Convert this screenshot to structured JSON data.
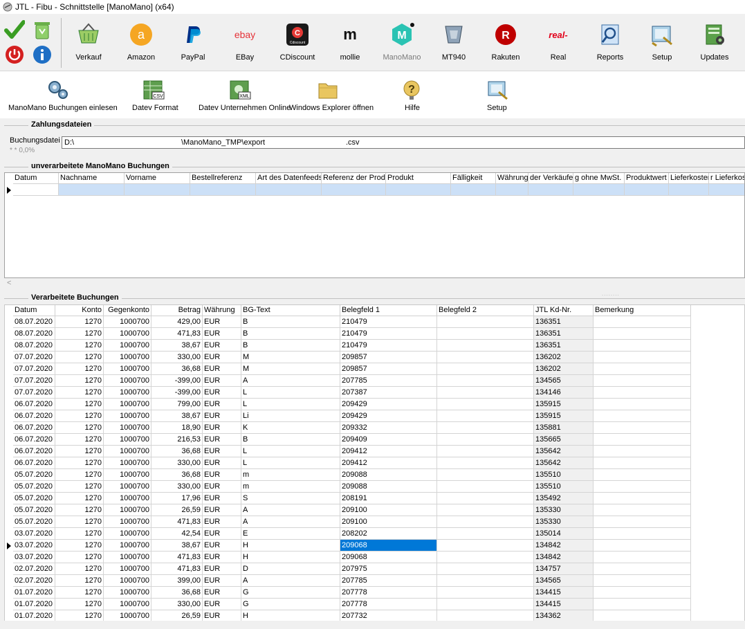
{
  "window": {
    "title": "JTL - Fibu - Schnittstelle [ManoMano] (x64)"
  },
  "toolbar": {
    "items": [
      {
        "label": "Verkauf",
        "icon": "shopping-basket-icon"
      },
      {
        "label": "Amazon",
        "icon": "amazon-icon"
      },
      {
        "label": "PayPal",
        "icon": "paypal-icon"
      },
      {
        "label": "EBay",
        "icon": "ebay-icon"
      },
      {
        "label": "CDiscount",
        "icon": "cdiscount-icon"
      },
      {
        "label": "mollie",
        "icon": "mollie-icon"
      },
      {
        "label": "ManoMano",
        "icon": "manomano-icon"
      },
      {
        "label": "MT940",
        "icon": "mt940-icon"
      },
      {
        "label": "Rakuten",
        "icon": "rakuten-icon"
      },
      {
        "label": "Real",
        "icon": "real-icon"
      },
      {
        "label": "Reports",
        "icon": "reports-icon"
      },
      {
        "label": "Setup",
        "icon": "setup-icon"
      },
      {
        "label": "Updates",
        "icon": "updates-icon"
      }
    ],
    "ebay_text": "ebay",
    "cdiscount_text": "Cdiscount",
    "mollie_text": "m",
    "rakuten_text": "R",
    "real_text": "real-",
    "manomano_text": "M"
  },
  "subtoolbar": {
    "items": [
      {
        "label": "ManoMano Buchungen einlesen",
        "icon": "gears-icon"
      },
      {
        "label": "Datev Format",
        "icon": "csv-file-icon"
      },
      {
        "label": "Datev Unternehmen Online",
        "icon": "xml-file-icon"
      },
      {
        "label": "Windows Explorer öffnen",
        "icon": "folder-icon"
      },
      {
        "label": "Hilfe",
        "icon": "help-icon"
      },
      {
        "label": "Setup",
        "icon": "setup-icon"
      }
    ],
    "csv_text": "CSV",
    "xml_text": "XML",
    "help_glyph": "?"
  },
  "payment_files": {
    "title": "Zahlungsdateien",
    "label": "Buchungsdatei",
    "progress": "* * 0,0%",
    "path_parts": [
      "D:\\",
      "\\ManoMano_TMP\\export",
      ".csv"
    ]
  },
  "unprocessed": {
    "title": "unverarbeitete ManoMano Buchungen",
    "columns": [
      "Datum",
      "Nachname",
      "Vorname",
      "Bestellreferenz",
      "Art des Datenfeeds",
      "Referenz der Produl",
      "Produkt",
      "Fälligkeit",
      "Währung",
      "der Verkäufe",
      "g ohne MwSt.",
      "Produktwert",
      "Lieferkosten",
      "r Lieferkos"
    ],
    "scroll_left": "<",
    "splitter": "........"
  },
  "processed": {
    "title": "Verarbeitete Buchungen",
    "columns": [
      "Datum",
      "Konto",
      "Gegenkonto",
      "Betrag",
      "Währung",
      "BG-Text",
      "Belegfeld 1",
      "Belegfeld 2",
      "JTL Kd-Nr.",
      "Bemerkung"
    ],
    "selected_row": 19,
    "rows": [
      [
        "08.07.2020",
        "1270",
        "1000700",
        "429,00",
        "EUR",
        "B",
        "210479",
        "",
        "136351",
        ""
      ],
      [
        "08.07.2020",
        "1270",
        "1000700",
        "471,83",
        "EUR",
        "B",
        "210479",
        "",
        "136351",
        ""
      ],
      [
        "08.07.2020",
        "1270",
        "1000700",
        "38,67",
        "EUR",
        "B",
        "210479",
        "",
        "136351",
        ""
      ],
      [
        "07.07.2020",
        "1270",
        "1000700",
        "330,00",
        "EUR",
        "M",
        "209857",
        "",
        "136202",
        ""
      ],
      [
        "07.07.2020",
        "1270",
        "1000700",
        "36,68",
        "EUR",
        "M",
        "209857",
        "",
        "136202",
        ""
      ],
      [
        "07.07.2020",
        "1270",
        "1000700",
        "-399,00",
        "EUR",
        "A",
        "207785",
        "",
        "134565",
        ""
      ],
      [
        "07.07.2020",
        "1270",
        "1000700",
        "-399,00",
        "EUR",
        "L",
        "207387",
        "",
        "134146",
        ""
      ],
      [
        "06.07.2020",
        "1270",
        "1000700",
        "799,00",
        "EUR",
        "L",
        "209429",
        "",
        "135915",
        ""
      ],
      [
        "06.07.2020",
        "1270",
        "1000700",
        "38,67",
        "EUR",
        "Li",
        "209429",
        "",
        "135915",
        ""
      ],
      [
        "06.07.2020",
        "1270",
        "1000700",
        "18,90",
        "EUR",
        "K",
        "209332",
        "",
        "135881",
        ""
      ],
      [
        "06.07.2020",
        "1270",
        "1000700",
        "216,53",
        "EUR",
        "B",
        "209409",
        "",
        "135665",
        ""
      ],
      [
        "06.07.2020",
        "1270",
        "1000700",
        "36,68",
        "EUR",
        "L",
        "209412",
        "",
        "135642",
        ""
      ],
      [
        "06.07.2020",
        "1270",
        "1000700",
        "330,00",
        "EUR",
        "L",
        "209412",
        "",
        "135642",
        ""
      ],
      [
        "05.07.2020",
        "1270",
        "1000700",
        "36,68",
        "EUR",
        "m",
        "209088",
        "",
        "135510",
        ""
      ],
      [
        "05.07.2020",
        "1270",
        "1000700",
        "330,00",
        "EUR",
        "m",
        "209088",
        "",
        "135510",
        ""
      ],
      [
        "05.07.2020",
        "1270",
        "1000700",
        "17,96",
        "EUR",
        "S",
        "208191",
        "",
        "135492",
        ""
      ],
      [
        "05.07.2020",
        "1270",
        "1000700",
        "26,59",
        "EUR",
        "A",
        "209100",
        "",
        "135330",
        ""
      ],
      [
        "05.07.2020",
        "1270",
        "1000700",
        "471,83",
        "EUR",
        "A",
        "209100",
        "",
        "135330",
        ""
      ],
      [
        "03.07.2020",
        "1270",
        "1000700",
        "42,54",
        "EUR",
        "E",
        "208202",
        "",
        "135014",
        ""
      ],
      [
        "03.07.2020",
        "1270",
        "1000700",
        "38,67",
        "EUR",
        "H",
        "209068",
        "",
        "134842",
        ""
      ],
      [
        "03.07.2020",
        "1270",
        "1000700",
        "471,83",
        "EUR",
        "H",
        "209068",
        "",
        "134842",
        ""
      ],
      [
        "02.07.2020",
        "1270",
        "1000700",
        "471,83",
        "EUR",
        "D",
        "207975",
        "",
        "134757",
        ""
      ],
      [
        "02.07.2020",
        "1270",
        "1000700",
        "399,00",
        "EUR",
        "A",
        "207785",
        "",
        "134565",
        ""
      ],
      [
        "01.07.2020",
        "1270",
        "1000700",
        "36,68",
        "EUR",
        "G",
        "207778",
        "",
        "134415",
        ""
      ],
      [
        "01.07.2020",
        "1270",
        "1000700",
        "330,00",
        "EUR",
        "G",
        "207778",
        "",
        "134415",
        ""
      ],
      [
        "01.07.2020",
        "1270",
        "1000700",
        "26,59",
        "EUR",
        "H",
        "207732",
        "",
        "134362",
        ""
      ]
    ]
  },
  "colors": {
    "selection": "#0078d7",
    "grid_row_highlight": "#cce0f7",
    "accent_green": "#3a9d23",
    "accent_red": "#d42020",
    "accent_blue": "#1f6fc5"
  }
}
